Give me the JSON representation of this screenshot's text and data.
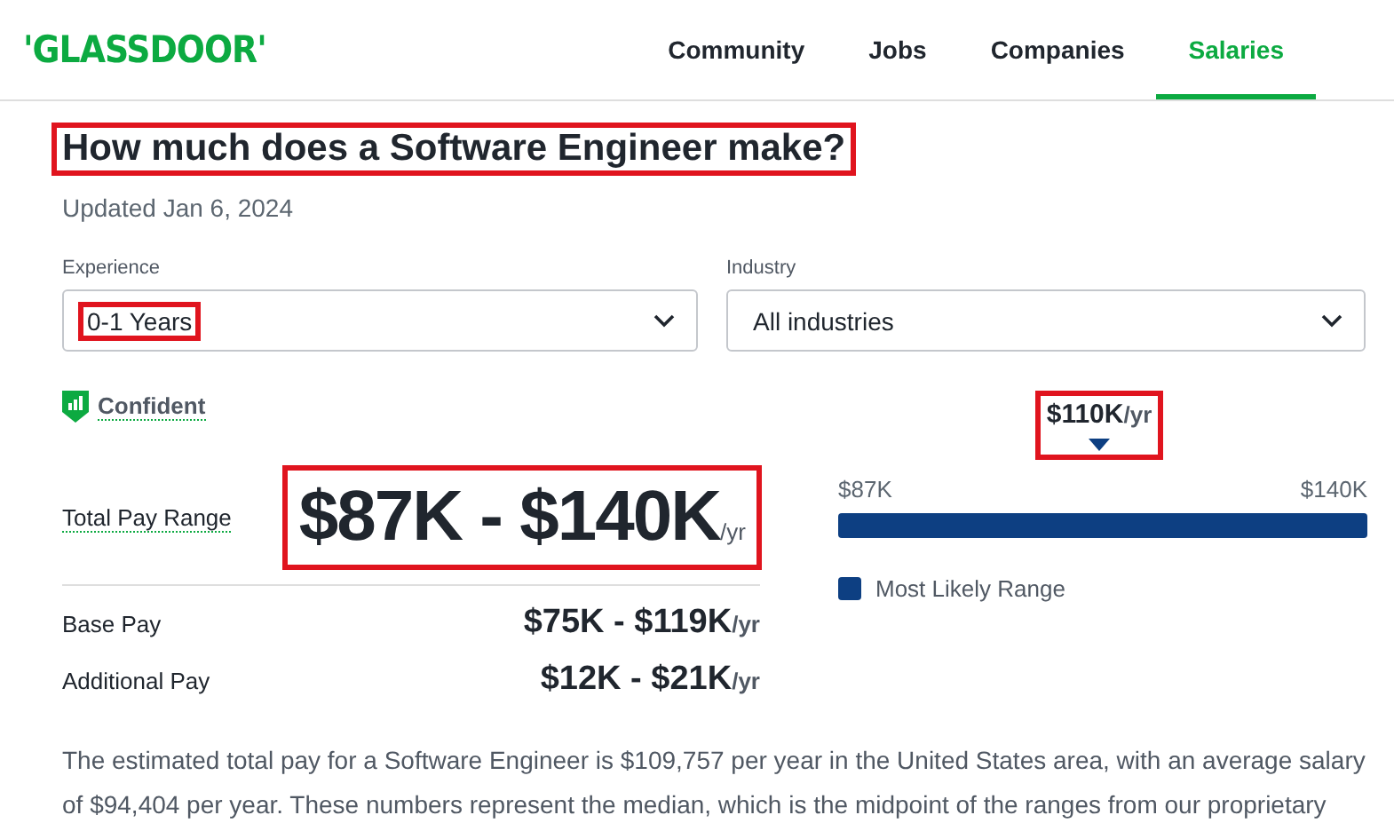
{
  "header": {
    "logo": "'GLASSDOOR'",
    "nav": [
      {
        "label": "Community",
        "selected": false
      },
      {
        "label": "Jobs",
        "selected": false
      },
      {
        "label": "Companies",
        "selected": false
      },
      {
        "label": "Salaries",
        "selected": true
      }
    ]
  },
  "title": {
    "text": "How much does a Software Engineer make?",
    "highlighted": true
  },
  "updated": "Updated Jan 6, 2024",
  "filters": [
    {
      "label": "Experience",
      "value": "0-1 Years",
      "highlighted": true
    },
    {
      "label": "Industry",
      "value": "All industries",
      "highlighted": false
    }
  ],
  "confidence": "Confident",
  "total_pay": {
    "label": "Total Pay Range",
    "range": "$87K - $140K",
    "unit": "/yr",
    "highlighted": true
  },
  "median": {
    "value": "$110K",
    "unit": "/yr",
    "highlighted": true
  },
  "range_bar": {
    "min": "$87K",
    "max": "$140K",
    "legend": "Most Likely Range"
  },
  "breakdown": [
    {
      "label": "Base Pay",
      "range": "$75K - $119K",
      "unit": "/yr"
    },
    {
      "label": "Additional Pay",
      "range": "$12K - $21K",
      "unit": "/yr"
    }
  ],
  "description": "The estimated total pay for a Software Engineer is $109,757 per year in the United States area, with an average salary of $94,404 per year. These numbers represent the median, which is the midpoint of the ranges from our proprietary"
}
